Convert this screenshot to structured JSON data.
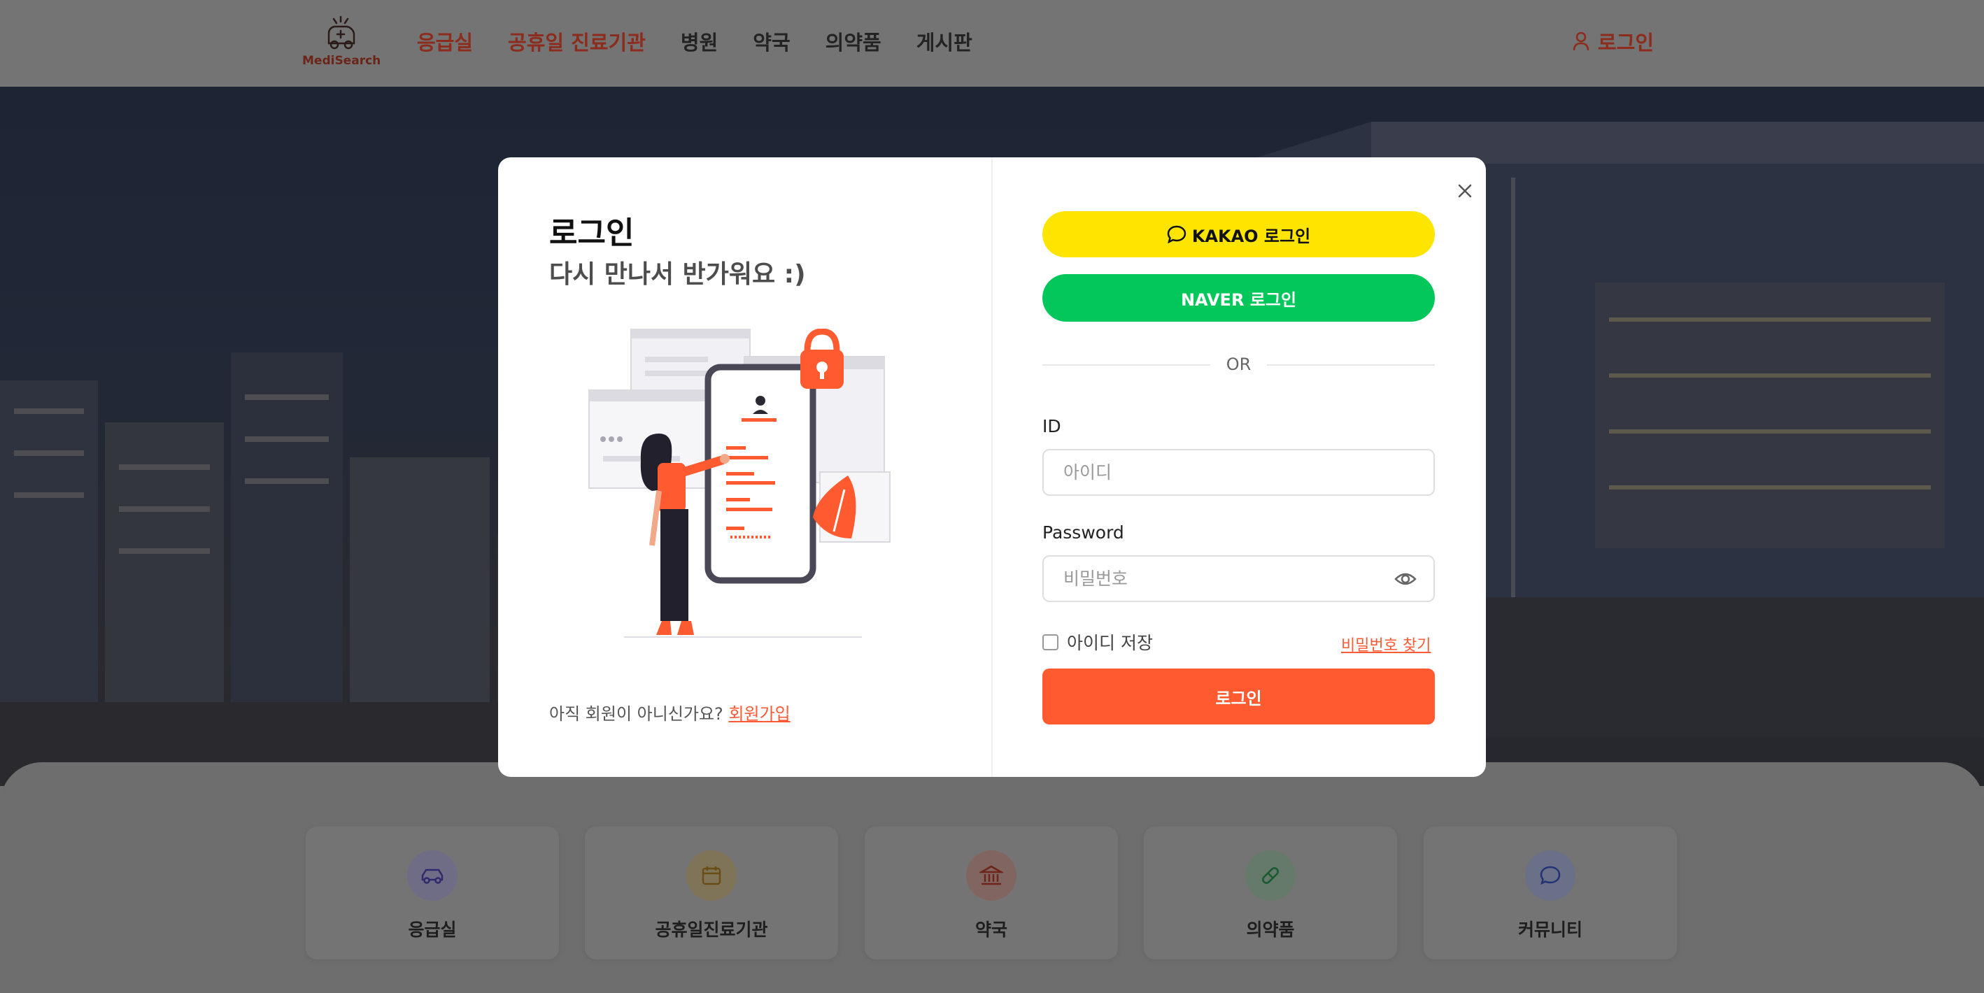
{
  "header": {
    "logo_text": "MediSearch",
    "nav": [
      "응급실",
      "공휴일 진료기관",
      "병원",
      "약국",
      "의약품",
      "게시판"
    ],
    "login_label": "로그인"
  },
  "quick_links": [
    {
      "label": "응급실",
      "icon": "car-icon"
    },
    {
      "label": "공휴일진료기관",
      "icon": "calendar-icon"
    },
    {
      "label": "약국",
      "icon": "building-icon"
    },
    {
      "label": "의약품",
      "icon": "pill-icon"
    },
    {
      "label": "커뮤니티",
      "icon": "chat-icon"
    }
  ],
  "modal": {
    "title": "로그인",
    "subtitle": "다시 만나서 반가워요 :)",
    "signup_prompt": "아직 회원이 아니신가요?",
    "signup_link": "회원가입",
    "kakao_label": "KAKAO 로그인",
    "naver_label": "NAVER 로그인",
    "or_text": "OR",
    "id_label": "ID",
    "id_placeholder": "아이디",
    "password_label": "Password",
    "password_placeholder": "비밀번호",
    "save_id_label": "아이디 저장",
    "find_password": "비밀번호 찾기",
    "login_button": "로그인"
  },
  "colors": {
    "accent": "#ff5a30",
    "kakao": "#fee500",
    "naver": "#03c75a"
  }
}
